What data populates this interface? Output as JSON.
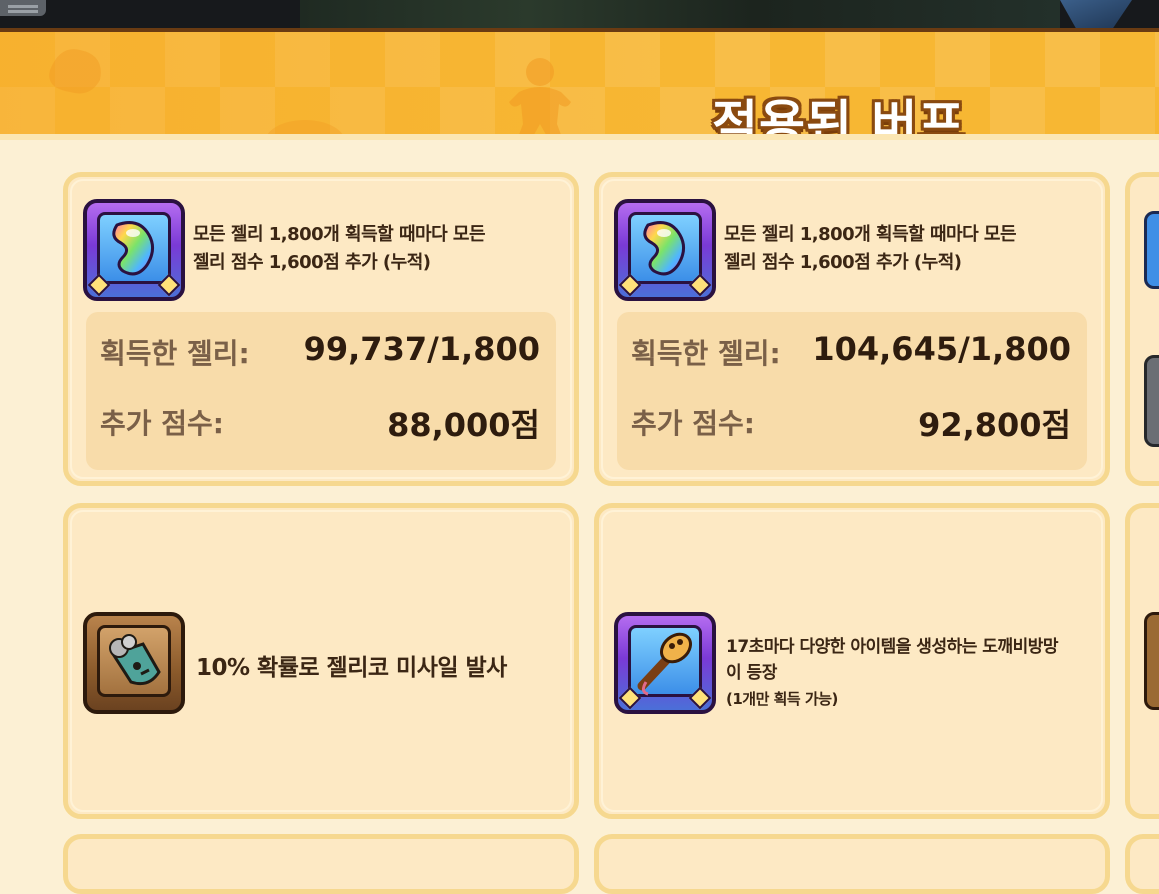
{
  "header": {
    "title": "적용된 버프"
  },
  "cards": [
    {
      "icon": "rainbow-jelly-bean-icon",
      "description_line1": "모든 젤리 1,800개 획득할 때마다 모든",
      "description_line2": "젤리 점수 1,600점 추가 (누적)",
      "stats": [
        {
          "label": "획득한 젤리:",
          "value": "99,737/1,800"
        },
        {
          "label": "추가 점수:",
          "value": "88,000점"
        }
      ]
    },
    {
      "icon": "rainbow-jelly-bean-icon",
      "description_line1": "모든 젤리 1,800개 획득할 때마다 모든",
      "description_line2": "젤리 점수 1,600점 추가 (누적)",
      "stats": [
        {
          "label": "획득한 젤리:",
          "value": "104,645/1,800"
        },
        {
          "label": "추가 점수:",
          "value": "92,800점"
        }
      ]
    },
    {
      "icon": "jelly-missile-icon",
      "description": "10% 확률로 젤리코 미사일 발사"
    },
    {
      "icon": "goblin-club-icon",
      "description_line1": "17초마다 다양한 아이템을 생성하는 도깨비방망",
      "description_line2": "이 등장",
      "note": "(1개만 획득 가능)"
    }
  ],
  "colors": {
    "header": "#f7b733",
    "card_bg": "#fde9c4",
    "card_border": "#f6d88f",
    "stats_bg": "#f8dcaa",
    "text_dark": "#2e1c0e"
  }
}
